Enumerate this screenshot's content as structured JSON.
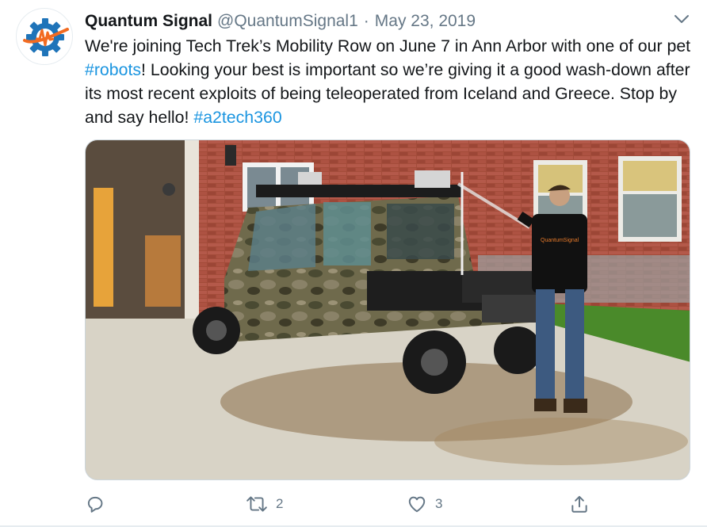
{
  "tweet": {
    "author": {
      "display_name": "Quantum Signal",
      "handle": "@QuantumSignal1",
      "separator": "·",
      "date": "May 23, 2019",
      "avatar_icon": "quantum-signal-gear-logo"
    },
    "text": {
      "part1": "We're joining Tech Trek’s Mobility Row on June 7 in Ann Arbor with one of our pet ",
      "hashtag1": "#robots",
      "part2": "! Looking your best is important so we’re giving it a good wash-down after its most recent exploits of being teleoperated from Iceland and Greece. Stop by and say hello! ",
      "hashtag2": "#a2tech360"
    },
    "media": {
      "shirt_logo_text": "QuantumSignal"
    },
    "actions": {
      "reply_icon": "reply-icon",
      "retweet_icon": "retweet-icon",
      "retweet_count": "2",
      "like_icon": "like-icon",
      "like_count": "3",
      "share_icon": "share-icon"
    },
    "colors": {
      "link": "#1b95e0",
      "secondary_text": "#657786",
      "primary_text": "#14171a",
      "logo_blue": "#1f74b9",
      "logo_orange": "#f26b21"
    }
  }
}
